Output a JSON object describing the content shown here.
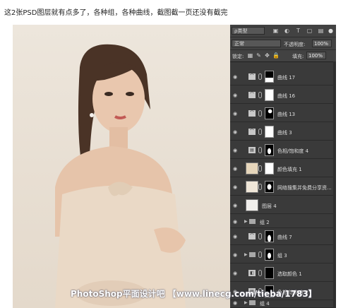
{
  "caption": "这2张PSD图层就有点多了，各种组，各种曲线，截图截一页还没有截完",
  "panel": {
    "kind_label": "ρ类型",
    "blend_mode": "正常",
    "opacity_label": "不透明度:",
    "opacity_value": "100%",
    "lock_label": "锁定:",
    "fill_label": "填充:",
    "fill_value": "100%"
  },
  "layers": [
    {
      "name": "曲线 17",
      "type": "adjustment"
    },
    {
      "name": "曲线 16",
      "type": "adjustment"
    },
    {
      "name": "曲线 13",
      "type": "adjustment"
    },
    {
      "name": "曲线 3",
      "type": "adjustment"
    },
    {
      "name": "色相/饱和度 4",
      "type": "adjustment"
    },
    {
      "name": "颜色填充 1",
      "type": "fill"
    },
    {
      "name": "网络搜集并免费分享资...",
      "type": "image"
    },
    {
      "name": "图层 4",
      "type": "image"
    },
    {
      "name": "组 2",
      "type": "group"
    },
    {
      "name": "曲线 7",
      "type": "adjustment"
    },
    {
      "name": "组 3",
      "type": "group"
    },
    {
      "name": "选取颜色 1",
      "type": "adjustment"
    },
    {
      "name": "色相/饱和度 2",
      "type": "adjustment"
    },
    {
      "name": "组 4",
      "type": "group"
    }
  ],
  "watermark": "PhotoShop平面设计吧 【www.linecg.com/tieba/1783】"
}
